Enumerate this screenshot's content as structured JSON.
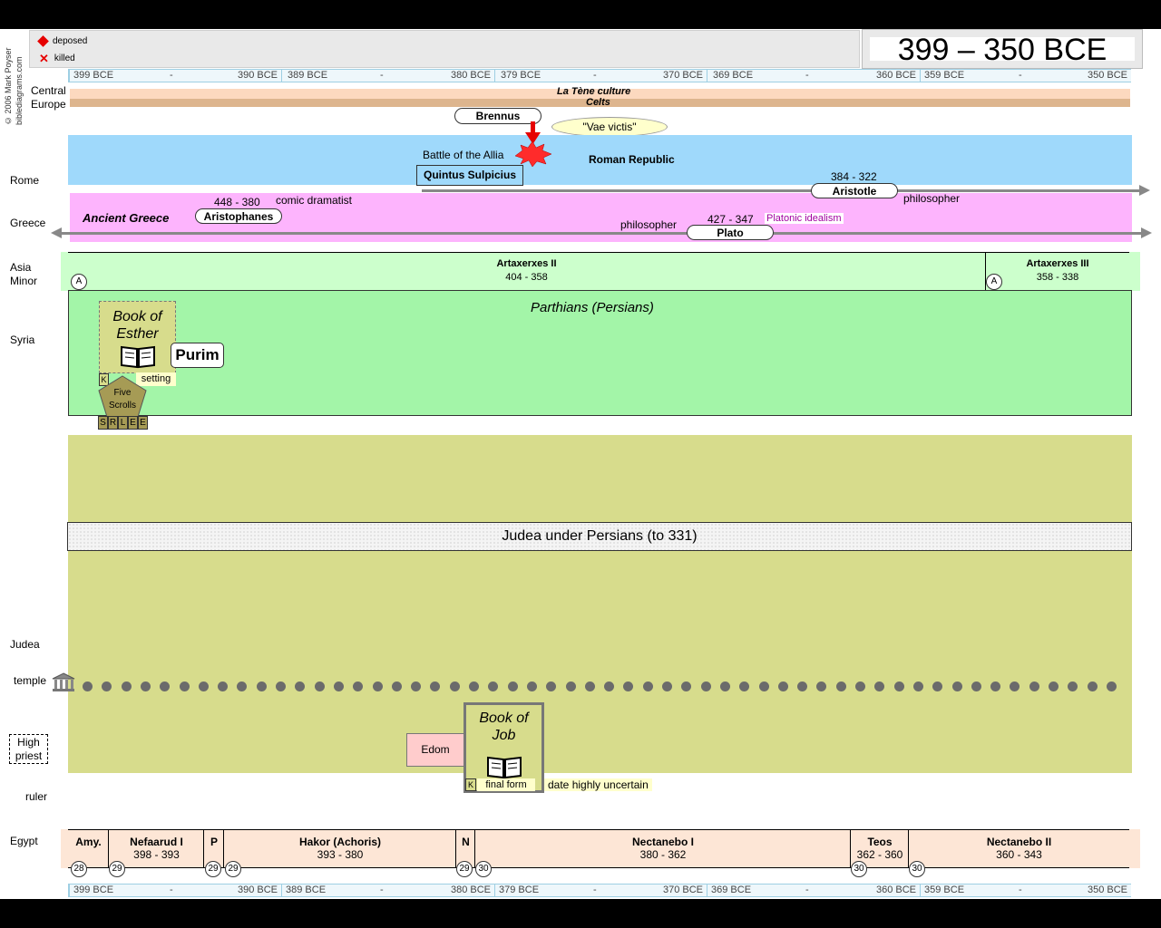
{
  "legend": {
    "deposed": "deposed",
    "killed": "killed"
  },
  "title": "399 – 350 BCE",
  "copyright": "© 2006 Mark Poyser biblediagrams.com",
  "scale": [
    {
      "start": "399 BCE",
      "mid": "-",
      "end": "390 BCE"
    },
    {
      "start": "389 BCE",
      "mid": "-",
      "end": "380 BCE"
    },
    {
      "start": "379 BCE",
      "mid": "-",
      "end": "370 BCE"
    },
    {
      "start": "369 BCE",
      "mid": "-",
      "end": "360 BCE"
    },
    {
      "start": "359 BCE",
      "mid": "-",
      "end": "350 BCE"
    }
  ],
  "rows": {
    "central_europe": "Central Europe",
    "rome": "Rome",
    "greece": "Greece",
    "asia_minor": "Asia Minor",
    "syria": "Syria",
    "judea": "Judea",
    "temple": "temple",
    "high_priest": "High priest",
    "ruler": "ruler",
    "egypt": "Egypt"
  },
  "europe": {
    "la_tene": "La Tène culture",
    "celts": "Celts",
    "brennus": "Brennus",
    "vae_victis": "\"Vae victis\""
  },
  "rome": {
    "battle": "Battle of the Allia",
    "republic": "Roman Republic",
    "sulpicius": "Quintus Sulpicius"
  },
  "greece": {
    "ancient_greece": "Ancient Greece",
    "aristophanes": "Aristophanes",
    "aristophanes_dates": "448 - 380",
    "aristophanes_role": "comic dramatist",
    "aristotle": "Aristotle",
    "aristotle_dates": "384 - 322",
    "aristotle_role": "philosopher",
    "plato": "Plato",
    "plato_dates": "427 - 347",
    "plato_role": "philosopher",
    "plato_school": "Platonic idealism"
  },
  "asia_minor": {
    "artaxerxes2": "Artaxerxes II",
    "artaxerxes2_dates": "404 - 358",
    "artaxerxes3": "Artaxerxes III",
    "artaxerxes3_dates": "358 - 338",
    "marker": "A"
  },
  "syria": {
    "parthians": "Parthians (Persians)",
    "esther": "Book of Esther",
    "purim": "Purim",
    "k": "K",
    "setting": "setting",
    "five_scrolls": "Five Scrolls",
    "scrolls": [
      "S",
      "R",
      "L",
      "E",
      "E"
    ]
  },
  "judea": {
    "under_persians": "Judea under Persians (to 331)",
    "edom": "Edom",
    "job": "Book of Job",
    "k": "K",
    "final_form": "final form",
    "uncertain": "date highly uncertain"
  },
  "egypt": [
    {
      "name": "Amy.",
      "dates": ""
    },
    {
      "name": "Nefaarud I",
      "dates": "398 - 393"
    },
    {
      "name": "P",
      "dates": ""
    },
    {
      "name": "Hakor (Achoris)",
      "dates": "393 - 380"
    },
    {
      "name": "N",
      "dates": ""
    },
    {
      "name": "Nectanebo I",
      "dates": "380 - 362"
    },
    {
      "name": "Teos",
      "dates": "362 - 360"
    },
    {
      "name": "Nectanebo II",
      "dates": "360 - 343"
    }
  ],
  "dynasties": [
    "28",
    "29",
    "29",
    "29",
    "29",
    "30",
    "30",
    "30"
  ],
  "colors": {
    "rome": "#9fd9fb",
    "greece": "#fdb4fd",
    "asia_minor": "#ccffcc",
    "syria": "#a3f5a8",
    "judea": "#d7dc8c",
    "egypt": "#fde6d6",
    "europe_tene": "#fcd9bf",
    "europe_celts": "#ddb58e"
  }
}
